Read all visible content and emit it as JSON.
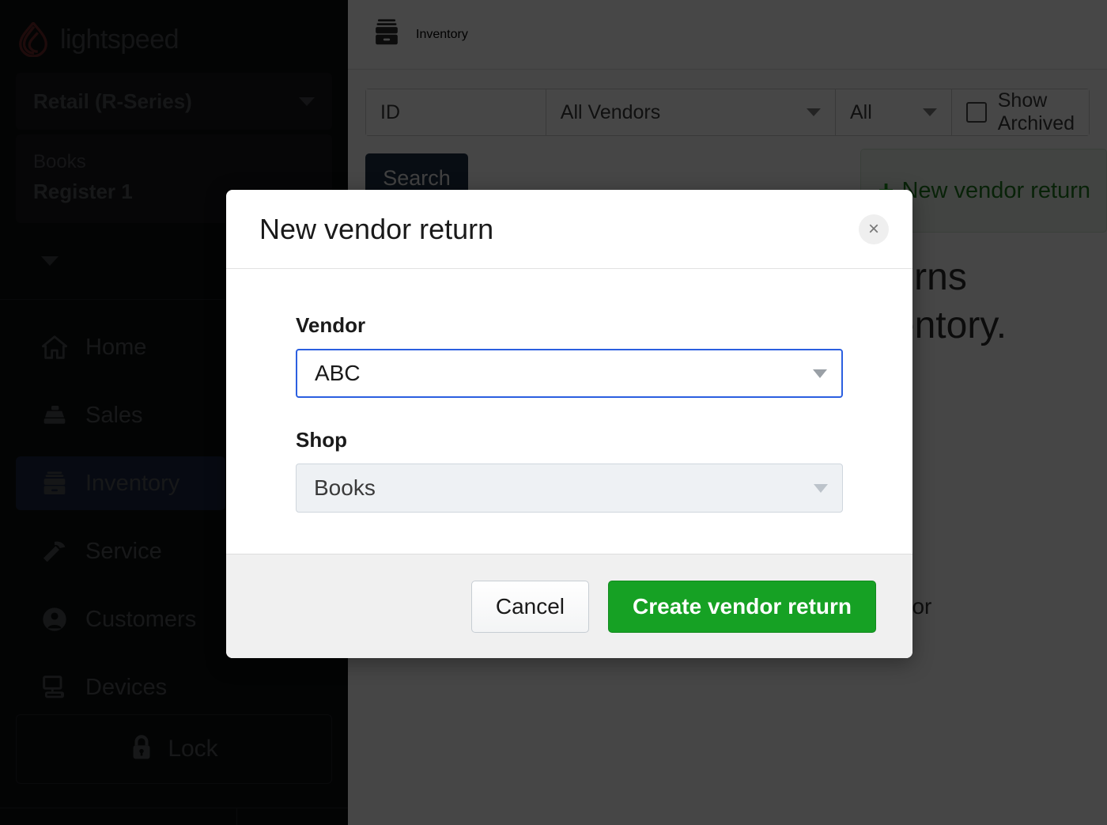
{
  "sidebar": {
    "brand": "lightspeed",
    "brand_logo_color": "#6e2a2a",
    "series_selector": "Retail (R-Series)",
    "shop_name": "Books",
    "register_name": "Register 1",
    "nav_items": [
      {
        "label": "Home",
        "icon": "home-icon",
        "active": false
      },
      {
        "label": "Sales",
        "icon": "sales-register-icon",
        "active": false
      },
      {
        "label": "Inventory",
        "icon": "inventory-box-icon",
        "active": true
      },
      {
        "label": "Service",
        "icon": "hammer-icon",
        "active": false
      },
      {
        "label": "Customers",
        "icon": "person-icon",
        "active": false
      },
      {
        "label": "Devices",
        "icon": "monitor-icon",
        "active": false
      }
    ],
    "active_nav_color": "#1b2740",
    "lock_button": "Lock",
    "lock_icon": "lock-icon"
  },
  "main": {
    "page_title": "Inventory",
    "page_icon": "inventory-box-icon",
    "filters": {
      "id_placeholder": "ID",
      "vendors_value": "All Vendors",
      "status_value": "All",
      "show_archived_label": "Show Archived",
      "show_archived_checked": false
    },
    "search_button": "Search",
    "new_return_button": "New vendor return",
    "new_return_icon": "plus-icon",
    "empty_heading": "Keep track of vendor returns\nand stay on top of your inventory.",
    "empty_subtext": "Manage and track returns for damaged or\nunsold items.",
    "accent_green": "#1f7a1f"
  },
  "modal": {
    "title": "New vendor return",
    "close_icon": "close-icon",
    "close_label": "×",
    "fields": [
      {
        "label": "Vendor",
        "value": "ABC",
        "state": "focused",
        "icon": "chevron-down-icon"
      },
      {
        "label": "Shop",
        "value": "Books",
        "state": "disabled",
        "icon": "chevron-down-icon"
      }
    ],
    "cancel_button": "Cancel",
    "submit_button": "Create vendor return",
    "submit_color": "#16a124",
    "focus_border_color": "#2b5fe0"
  }
}
